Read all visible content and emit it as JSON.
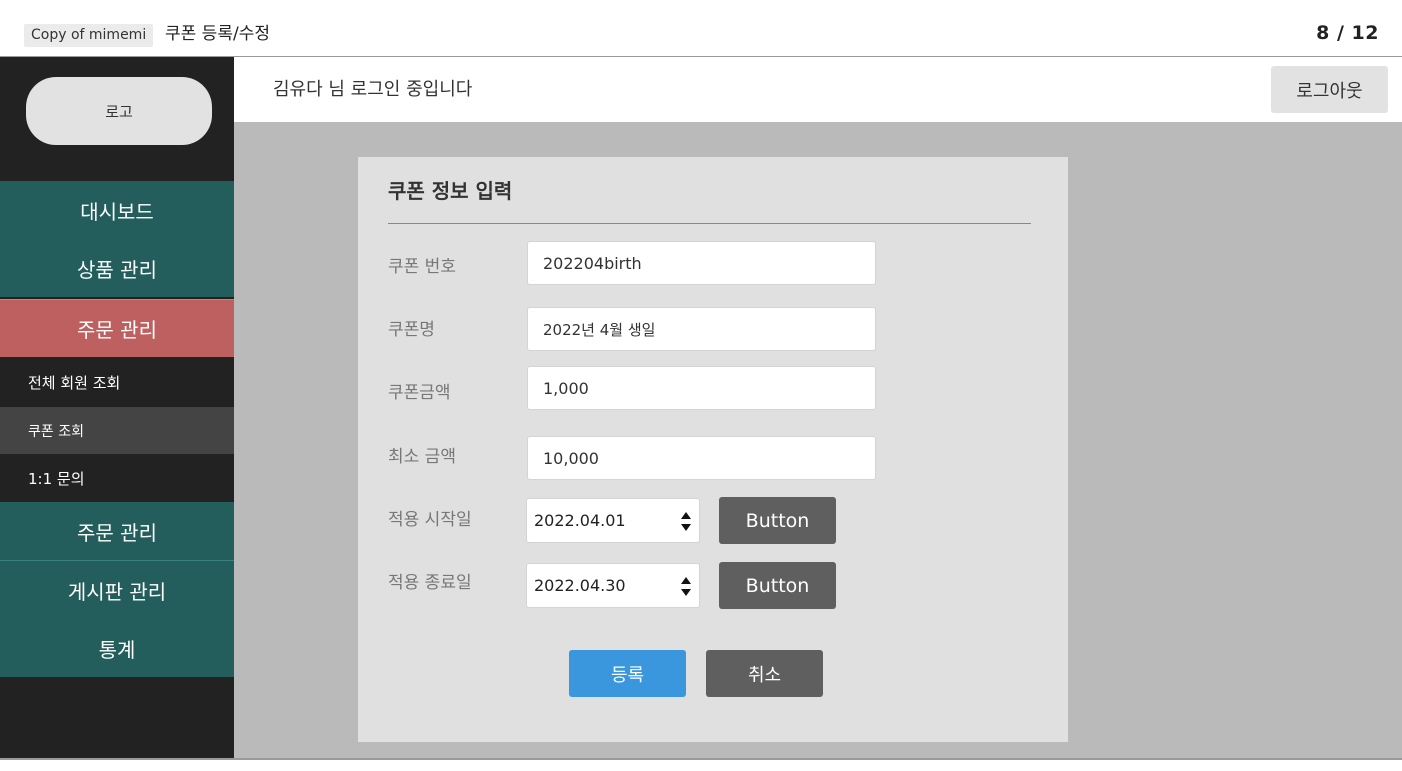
{
  "viewer": {
    "doc_tag": "Copy of mimemi",
    "doc_title": "쿠폰 등록/수정",
    "page_count": "8 / 12"
  },
  "sidebar": {
    "logo": "로고",
    "items": [
      {
        "label": "대시보드"
      },
      {
        "label": "상품 관리"
      },
      {
        "label": "주문 관리"
      },
      {
        "label": "전체 회원 조회"
      },
      {
        "label": "쿠폰 조회"
      },
      {
        "label": "1:1 문의"
      },
      {
        "label": "주문 관리"
      },
      {
        "label": "게시판 관리"
      },
      {
        "label": "통계"
      }
    ]
  },
  "header": {
    "login_text": "김유다 님 로그인 중입니다",
    "logout_label": "로그아웃"
  },
  "form": {
    "title": "쿠폰 정보 입력",
    "coupon_number": {
      "label": "쿠폰 번호",
      "value": "202204birth"
    },
    "coupon_name": {
      "label": "쿠폰명",
      "value": "2022년 4월 생일"
    },
    "coupon_amount": {
      "label": "쿠폰금액",
      "value": "1,000"
    },
    "min_amount": {
      "label": "최소 금액",
      "value": "10,000"
    },
    "start_date": {
      "label": "적용 시작일",
      "value": "2022.04.01",
      "button": "Button"
    },
    "end_date": {
      "label": "적용 종료일",
      "value": "2022.04.30",
      "button": "Button"
    },
    "submit_label": "등록",
    "cancel_label": "취소"
  },
  "colors": {
    "sidebar_bg": "#222222",
    "nav_teal": "#235e5d",
    "nav_active": "#bf6060",
    "content_bg": "#bababa",
    "card_bg": "#e0e0e0",
    "primary_button": "#3a97dd",
    "secondary_button": "#5f5f5f"
  }
}
